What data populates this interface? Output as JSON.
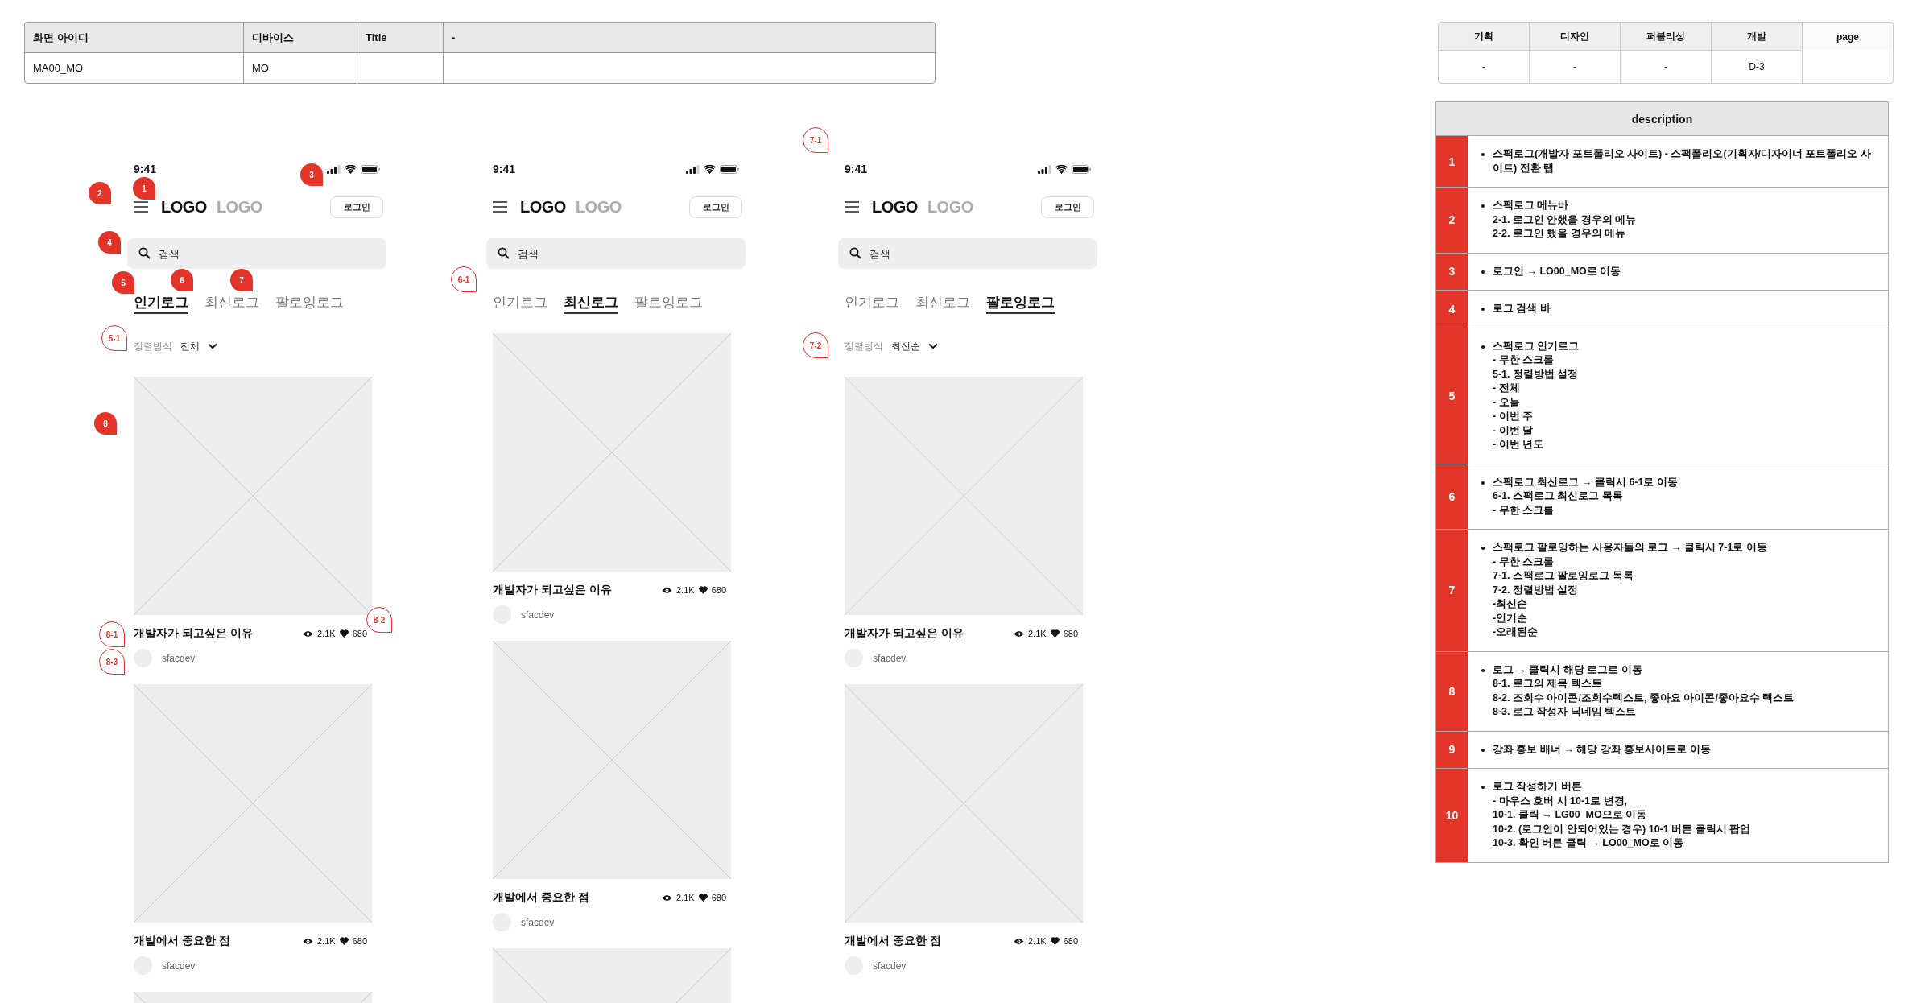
{
  "screen_info": {
    "columns": [
      "화면 아이디",
      "디바이스",
      "Title",
      "-"
    ],
    "row": [
      "MA00_MO",
      "MO"
    ]
  },
  "status_table": {
    "columns": [
      "기획",
      "디자인",
      "퍼블리싱",
      "개발",
      "page"
    ],
    "values": [
      "-",
      "-",
      "-",
      "D-3"
    ]
  },
  "phones": [
    {
      "time": "9:41",
      "logos": [
        {
          "text": "LOGO",
          "selected": true
        },
        {
          "text": "LOGO",
          "selected": false
        }
      ],
      "login": "로그인",
      "search_placeholder": "검색",
      "tabs": [
        {
          "label": "인기로그",
          "selected": true
        },
        {
          "label": "최신로그",
          "selected": false
        },
        {
          "label": "팔로잉로그",
          "selected": false
        }
      ],
      "sort": {
        "label": "정렬방식",
        "value": "전체"
      },
      "cards": [
        {
          "kind": "post",
          "title": "개발자가 되고싶은 이유",
          "views": "2.1K",
          "likes": "680",
          "author": "sfacdev"
        },
        {
          "kind": "post",
          "title": "개발에서 중요한 점",
          "views": "2.1K",
          "likes": "680",
          "author": "sfacdev"
        },
        {
          "kind": "image"
        }
      ]
    },
    {
      "time": "9:41",
      "logos": [
        {
          "text": "LOGO",
          "selected": true
        },
        {
          "text": "LOGO",
          "selected": false
        }
      ],
      "login": "로그인",
      "search_placeholder": "검색",
      "tabs": [
        {
          "label": "인기로그",
          "selected": false
        },
        {
          "label": "최신로그",
          "selected": true
        },
        {
          "label": "팔로잉로그",
          "selected": false
        }
      ],
      "cards": [
        {
          "kind": "post",
          "title": "개발자가 되고싶은 이유",
          "views": "2.1K",
          "likes": "680",
          "author": "sfacdev"
        },
        {
          "kind": "post",
          "title": "개발에서 중요한 점",
          "views": "2.1K",
          "likes": "680",
          "author": "sfacdev"
        },
        {
          "kind": "image"
        }
      ]
    },
    {
      "time": "9:41",
      "logos": [
        {
          "text": "LOGO",
          "selected": true
        },
        {
          "text": "LOGO",
          "selected": false
        }
      ],
      "login": "로그인",
      "search_placeholder": "검색",
      "tabs": [
        {
          "label": "인기로그",
          "selected": false
        },
        {
          "label": "최신로그",
          "selected": false
        },
        {
          "label": "팔로잉로그",
          "selected": true
        }
      ],
      "sort": {
        "label": "정렬방식",
        "value": "최신순"
      },
      "cards": [
        {
          "kind": "post",
          "title": "개발자가 되고싶은 이유",
          "views": "2.1K",
          "likes": "680",
          "author": "sfacdev"
        },
        {
          "kind": "post",
          "title": "개발에서 중요한 점",
          "views": "2.1K",
          "likes": "680",
          "author": "sfacdev"
        }
      ]
    }
  ],
  "markers": [
    {
      "label": "1",
      "kind": "filled"
    },
    {
      "label": "2",
      "kind": "filled"
    },
    {
      "label": "3",
      "kind": "filled"
    },
    {
      "label": "4",
      "kind": "filled"
    },
    {
      "label": "5",
      "kind": "filled"
    },
    {
      "label": "6",
      "kind": "filled"
    },
    {
      "label": "7",
      "kind": "filled"
    },
    {
      "label": "5-1",
      "kind": "outline"
    },
    {
      "label": "8",
      "kind": "filled"
    },
    {
      "label": "8-1",
      "kind": "outline"
    },
    {
      "label": "8-2",
      "kind": "outline"
    },
    {
      "label": "8-3",
      "kind": "outline"
    },
    {
      "label": "6-1",
      "kind": "outline"
    },
    {
      "label": "7-1",
      "kind": "outline"
    },
    {
      "label": "7-2",
      "kind": "outline"
    }
  ],
  "description": {
    "title": "description",
    "rows": [
      {
        "number": "1",
        "lines": [
          "스팩로그(개발자 포트폴리오 사이트) - 스팩폴리오(기획자/디자이너 포트폴리오 사이트) 전환 탭"
        ]
      },
      {
        "number": "2",
        "lines": [
          "스팩로그 메뉴바",
          "2-1. 로그인 안했을 경우의 메뉴",
          "2-2. 로그인 했을 경우의 메뉴"
        ]
      },
      {
        "number": "3",
        "lines": [
          "로그인 → LO00_MO로 이동"
        ]
      },
      {
        "number": "4",
        "lines": [
          "로그 검색 바"
        ]
      },
      {
        "number": "5",
        "lines": [
          "스팩로그 인기로그",
          "- 무한 스크롤",
          "5-1. 정렬방법 설정",
          "- 전체",
          "- 오늘",
          "- 이번 주",
          "- 이번 달",
          "- 이번 년도"
        ]
      },
      {
        "number": "6",
        "lines": [
          "스팩로그 최신로그 → 클릭시 6-1로 이동",
          "6-1. 스팩로그 최신로그 목록",
          "- 무한 스크롤"
        ]
      },
      {
        "number": "7",
        "lines": [
          "스팩로그 팔로잉하는 사용자들의 로그 → 클릭시 7-1로 이동",
          "- 무한 스크롤",
          "7-1. 스팩로그 팔로잉로그 목록",
          "7-2. 정렬방법 설정",
          "-최신순",
          "-인기순",
          "-오래된순"
        ]
      },
      {
        "number": "8",
        "lines": [
          "로그 → 클릭시 해당 로그로 이동",
          "8-1. 로그의 제목 텍스트",
          "8-2. 조회수 아이콘/조회수텍스트,  좋아요 아이콘/좋아요수 텍스트",
          "8-3. 로그 작성자 닉네임 텍스트"
        ]
      },
      {
        "number": "9",
        "lines": [
          "강좌 홍보 배너 → 해당 강좌 홍보사이트로 이동"
        ]
      },
      {
        "number": "10",
        "lines": [
          "로그 작성하기 버튼",
          "- 마우스 호버 시 10-1로 변경,",
          "10-1. 클릭 → LG00_MO으로 이동",
          "10-2. (로그인이 안되어있는 경우) 10-1 버튼 클릭시 팝업",
          "10-3. 확인 버튼 클릭 → LO00_MO로 이동"
        ]
      }
    ]
  }
}
